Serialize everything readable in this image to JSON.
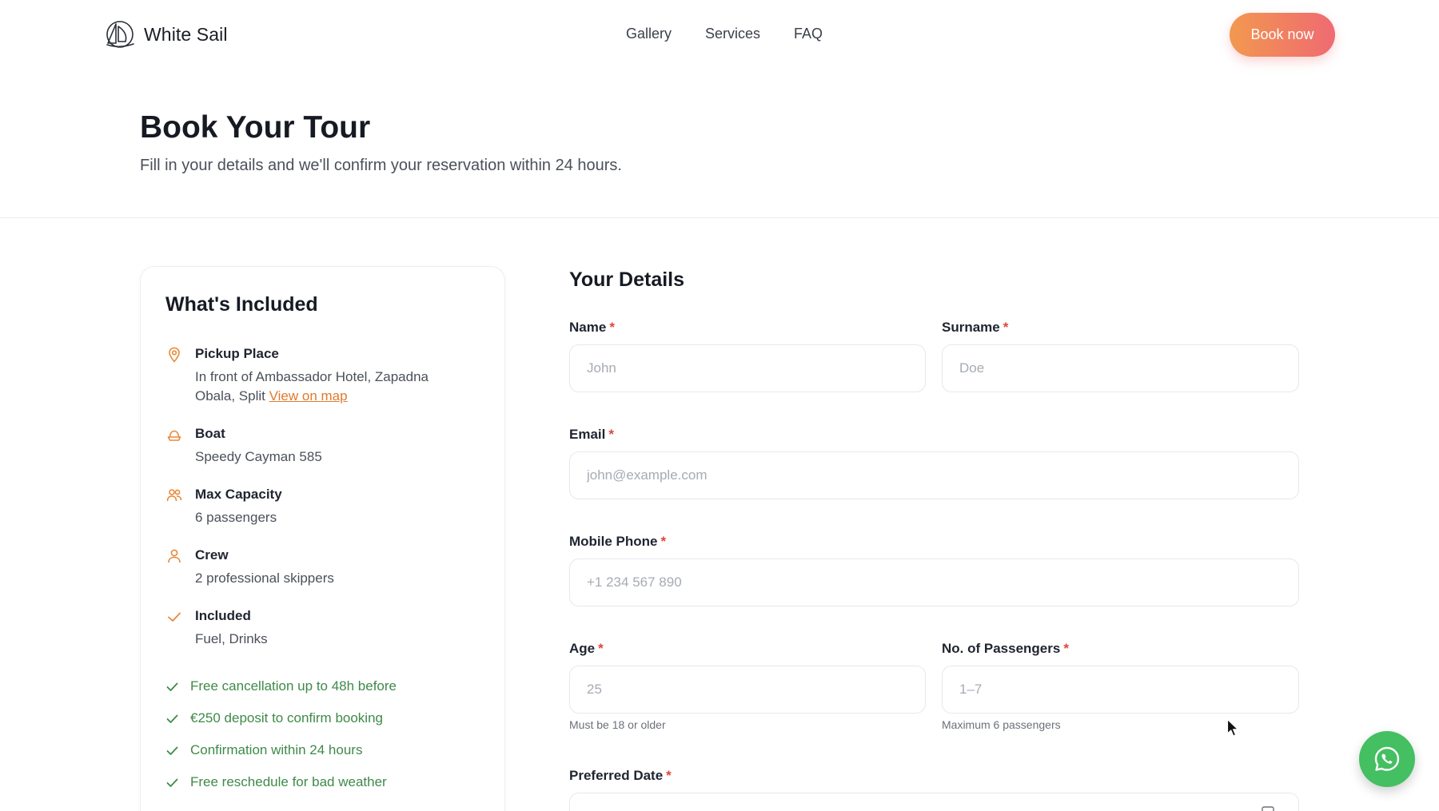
{
  "header": {
    "brand": "White Sail",
    "nav": [
      {
        "label": "Gallery"
      },
      {
        "label": "Services"
      },
      {
        "label": "FAQ"
      }
    ],
    "cta_label": "Book now"
  },
  "hero": {
    "title": "Book Your Tour",
    "subtitle": "Fill in your details and we'll confirm your reservation within 24 hours."
  },
  "included": {
    "title": "What's Included",
    "items": [
      {
        "icon": "location-pin-icon",
        "title": "Pickup Place",
        "value": "In front of Ambassador Hotel, Zapadna Obala, Split",
        "link": "View on map"
      },
      {
        "icon": "boat-icon",
        "title": "Boat",
        "value": "Speedy Cayman 585"
      },
      {
        "icon": "users-icon",
        "title": "Max Capacity",
        "value": "6 passengers"
      },
      {
        "icon": "user-icon",
        "title": "Crew",
        "value": "2 professional skippers"
      },
      {
        "icon": "check-icon",
        "title": "Included",
        "value": "Fuel, Drinks"
      }
    ],
    "benefits": [
      "Free cancellation up to 48h before",
      "€250 deposit to confirm booking",
      "Confirmation within 24 hours",
      "Free reschedule for bad weather"
    ]
  },
  "form": {
    "title": "Your Details",
    "required_mark": "*",
    "name": {
      "label": "Name",
      "placeholder": "John"
    },
    "surname": {
      "label": "Surname",
      "placeholder": "Doe"
    },
    "email": {
      "label": "Email",
      "placeholder": "john@example.com"
    },
    "phone": {
      "label": "Mobile Phone",
      "placeholder": "+1 234 567 890"
    },
    "age": {
      "label": "Age",
      "placeholder": "25",
      "hint": "Must be 18 or older"
    },
    "passengers": {
      "label": "No. of Passengers",
      "placeholder": "1–7",
      "hint": "Maximum 6 passengers"
    },
    "date": {
      "label": "Preferred Date"
    }
  },
  "colors": {
    "accent_orange": "#e07a2e",
    "cta_gradient_start": "#f2984f",
    "cta_gradient_end": "#ef6a72",
    "benefit_green": "#3e8a48",
    "whatsapp_green": "#44bf61",
    "required_red": "#e2443a"
  },
  "floating": {
    "icon": "whatsapp-icon"
  }
}
